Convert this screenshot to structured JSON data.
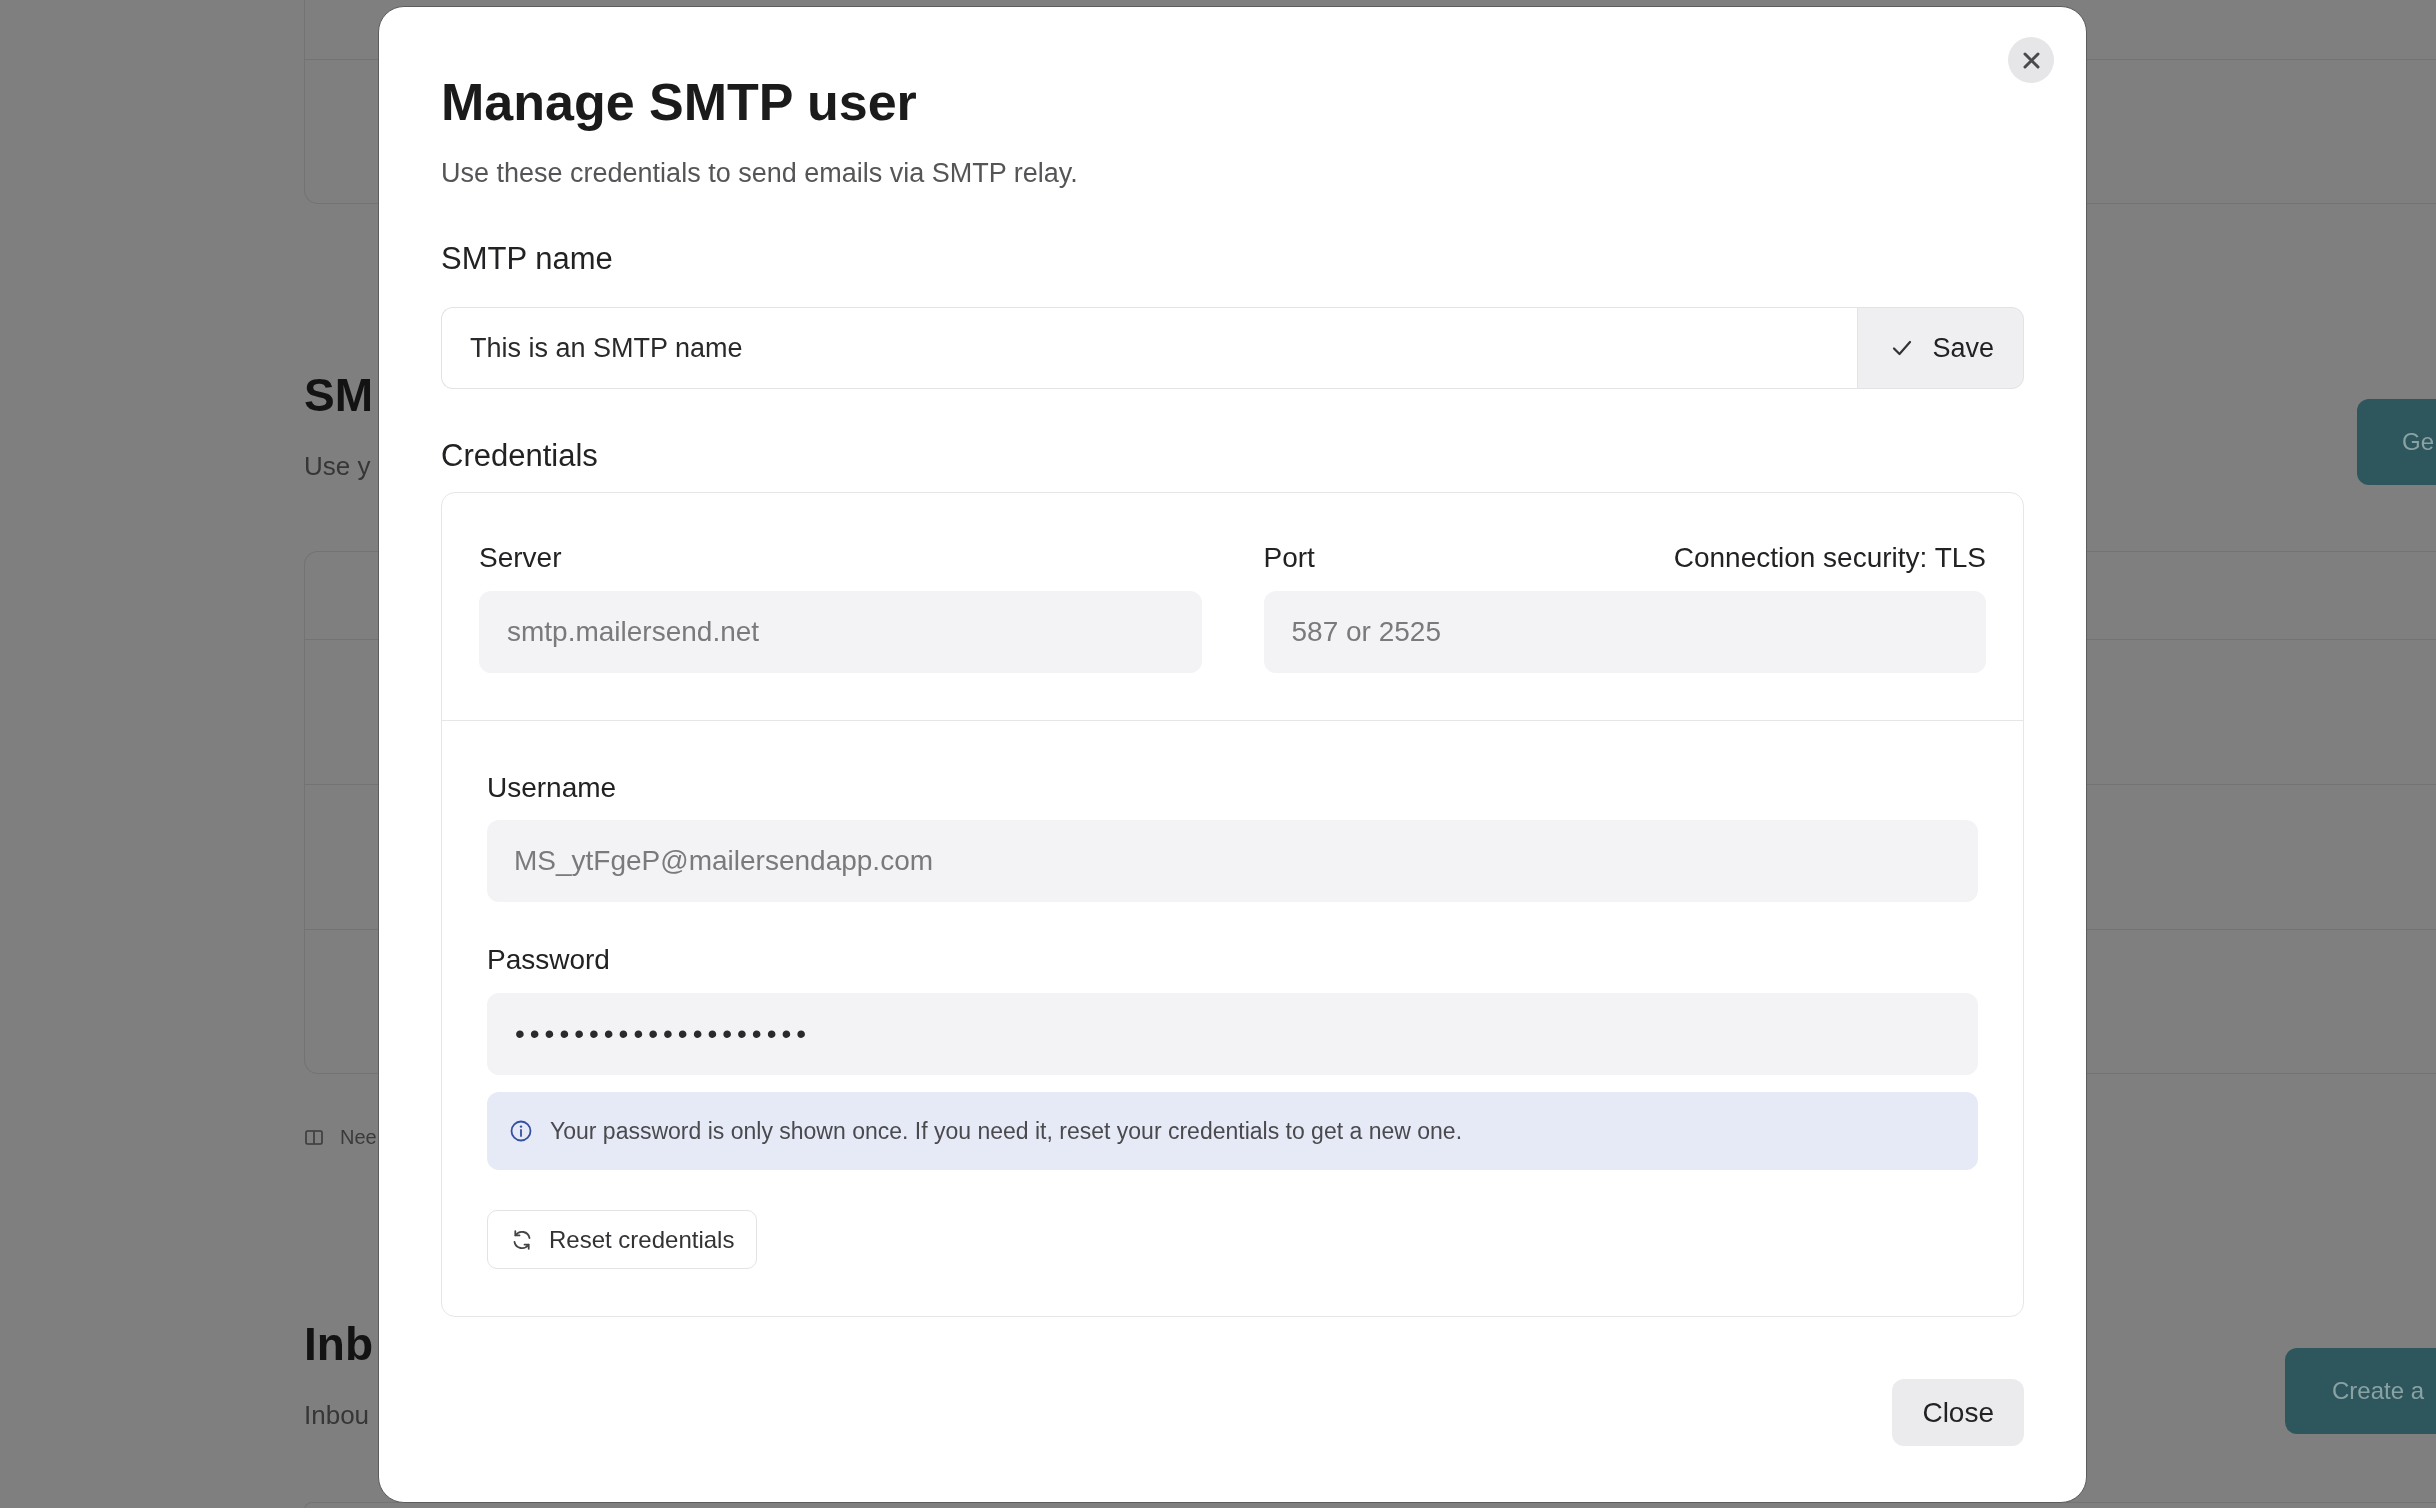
{
  "background_page": {
    "smtp_section": {
      "title": "SM",
      "description": "Use y",
      "button": "Ge"
    },
    "help_link": "Nee",
    "inbound_section": {
      "title": "Inb",
      "description": "Inbou",
      "button": "Create a"
    }
  },
  "dialog": {
    "title": "Manage SMTP user",
    "description": "Use these credentials to send emails via SMTP relay.",
    "smtp_name": {
      "label": "SMTP name",
      "field": {
        "value": "This is an SMTP name",
        "disabled": false
      },
      "save_button": "Save"
    },
    "credentials": {
      "label": "Credentials",
      "server": {
        "label": "Server",
        "value": "smtp.mailersend.net",
        "disabled": true
      },
      "port": {
        "label": "Port",
        "value": "587 or 2525",
        "disabled": true
      },
      "connection_security": "Connection security: TLS",
      "username": {
        "label": "Username",
        "value": "MS_ytFgeP@mailersendapp.com",
        "disabled": true
      },
      "password": {
        "label": "Password",
        "value": "••••••••••••••••••••",
        "disabled": false
      },
      "notice": "Your password is only shown once. If you need it, reset your credentials to get a new one.",
      "reset_button": "Reset credentials"
    },
    "close_button": "Close"
  }
}
